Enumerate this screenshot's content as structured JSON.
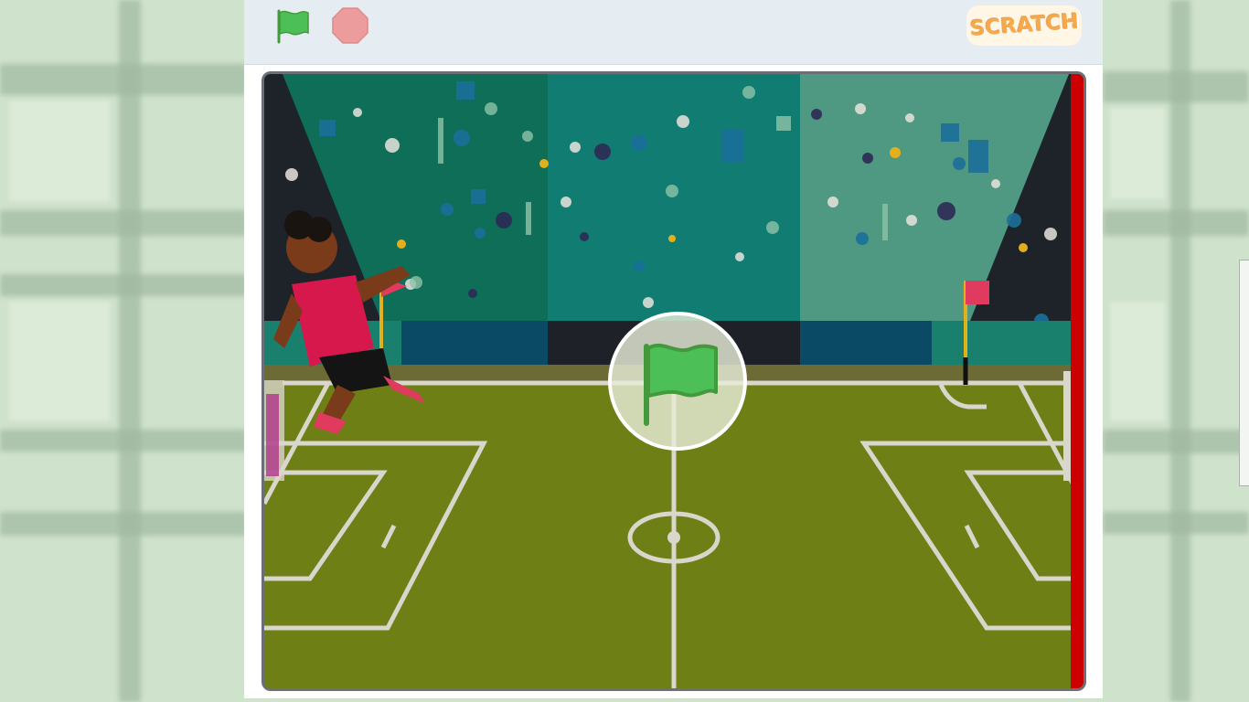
{
  "controls": {
    "green_flag": {
      "icon": "green-flag-icon",
      "color": "#4cbf56"
    },
    "stop": {
      "icon": "stop-icon",
      "color": "#ec9c9c"
    }
  },
  "logo": {
    "text": "SCRATCH",
    "color": "#f5a94a"
  },
  "stage": {
    "backdrop": "soccer-stadium",
    "sprite": "soccer-player",
    "overlay": {
      "icon": "green-flag-icon"
    }
  },
  "colors": {
    "grass": "#6e7f16",
    "grass_light": "#84951f",
    "lines": "#d9d6cc",
    "crowd_left": "#0e6e57",
    "crowd_mid": "#117c71",
    "crowd_right": "#4f9882",
    "stage_border": "#6b6f78",
    "right_edge": "#cc0000"
  }
}
